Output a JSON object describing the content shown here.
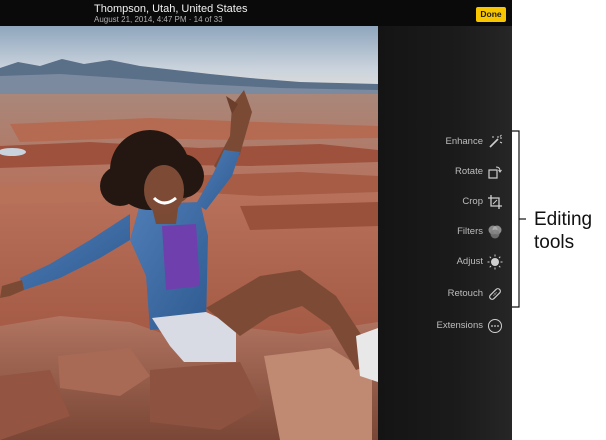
{
  "header": {
    "title": "Thompson, Utah, United States",
    "subtitle": "August 21, 2014, 4:47 PM · 14 of 33",
    "done_label": "Done"
  },
  "tools": [
    {
      "label": "Enhance",
      "icon": "magic-wand-icon"
    },
    {
      "label": "Rotate",
      "icon": "rotate-icon"
    },
    {
      "label": "Crop",
      "icon": "crop-icon"
    },
    {
      "label": "Filters",
      "icon": "filters-icon"
    },
    {
      "label": "Adjust",
      "icon": "adjust-dial-icon"
    },
    {
      "label": "Retouch",
      "icon": "bandage-icon"
    },
    {
      "label": "Extensions",
      "icon": "more-ellipsis-icon"
    }
  ],
  "callout": {
    "line1": "Editing",
    "line2": "tools"
  },
  "colors": {
    "done_button": "#f7c600",
    "panel": "#1b1b1b"
  }
}
